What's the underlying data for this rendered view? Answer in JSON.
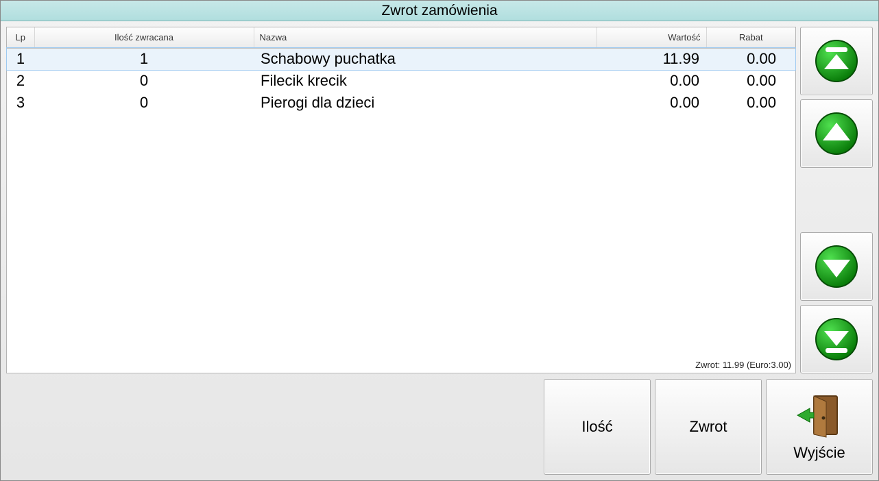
{
  "window": {
    "title": "Zwrot zamówienia"
  },
  "table": {
    "headers": {
      "lp": "Lp",
      "qty": "Ilość zwracana",
      "name": "Nazwa",
      "value": "Wartość",
      "rabat": "Rabat"
    },
    "rows": [
      {
        "lp": "1",
        "qty": "1",
        "name": "Schabowy puchatka",
        "value": "11.99",
        "rabat": "0.00",
        "selected": true
      },
      {
        "lp": "2",
        "qty": "0",
        "name": "Filecik krecik",
        "value": "0.00",
        "rabat": "0.00",
        "selected": false
      },
      {
        "lp": "3",
        "qty": "0",
        "name": "Pierogi dla dzieci",
        "value": "0.00",
        "rabat": "0.00",
        "selected": false
      }
    ],
    "summary": "Zwrot: 11.99 (Euro:3.00)"
  },
  "buttons": {
    "qty": "Ilość",
    "zwrot": "Zwrot",
    "exit": "Wyjście"
  },
  "icons": {
    "scroll_top": "scroll-top-icon",
    "scroll_up": "scroll-up-icon",
    "scroll_down": "scroll-down-icon",
    "scroll_bottom": "scroll-bottom-icon",
    "exit": "exit-door-icon"
  }
}
